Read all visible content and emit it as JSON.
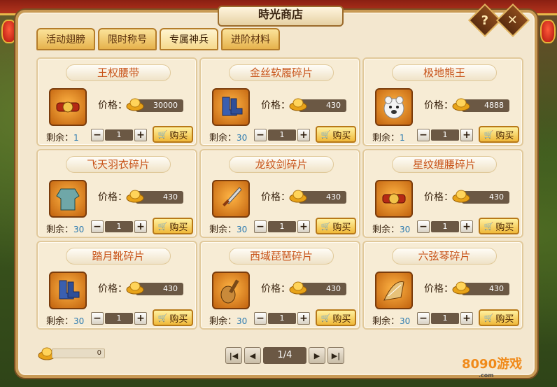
{
  "window": {
    "title": "時光商店",
    "help_label": "?",
    "close_label": "✕"
  },
  "colors": {
    "accent": "#c8541a",
    "panel": "#f3e7cf",
    "button": "#f0b93a"
  },
  "tabs": [
    {
      "label": "活动翅膀",
      "active": false
    },
    {
      "label": "限时称号",
      "active": false
    },
    {
      "label": "专属神兵",
      "active": true
    },
    {
      "label": "进阶材料",
      "active": false
    }
  ],
  "labels": {
    "price": "价格：",
    "remain": "剩余：",
    "buy": "购买",
    "minus": "−",
    "plus": "+"
  },
  "items": [
    {
      "name": "王权腰带",
      "price": "30000",
      "remain": "1",
      "qty": "1",
      "icon": "belt-icon"
    },
    {
      "name": "金丝软履碎片",
      "price": "430",
      "remain": "30",
      "qty": "1",
      "icon": "boots-icon"
    },
    {
      "name": "极地熊王",
      "price": "4888",
      "remain": "1",
      "qty": "1",
      "icon": "bear-icon"
    },
    {
      "name": "飞天羽衣碎片",
      "price": "430",
      "remain": "30",
      "qty": "1",
      "icon": "robe-icon"
    },
    {
      "name": "龙纹剑碎片",
      "price": "430",
      "remain": "30",
      "qty": "1",
      "icon": "sword-icon"
    },
    {
      "name": "星纹缠腰碎片",
      "price": "430",
      "remain": "30",
      "qty": "1",
      "icon": "belt-icon"
    },
    {
      "name": "踏月靴碎片",
      "price": "430",
      "remain": "30",
      "qty": "1",
      "icon": "boots-icon"
    },
    {
      "name": "西域琵琶碎片",
      "price": "430",
      "remain": "30",
      "qty": "1",
      "icon": "pipa-icon"
    },
    {
      "name": "六弦琴碎片",
      "price": "430",
      "remain": "30",
      "qty": "1",
      "icon": "harp-icon"
    }
  ],
  "wallet": {
    "amount": "0"
  },
  "pager": {
    "page": "1/4"
  },
  "watermark": {
    "text": "8090游戏",
    "sub": ".com"
  }
}
